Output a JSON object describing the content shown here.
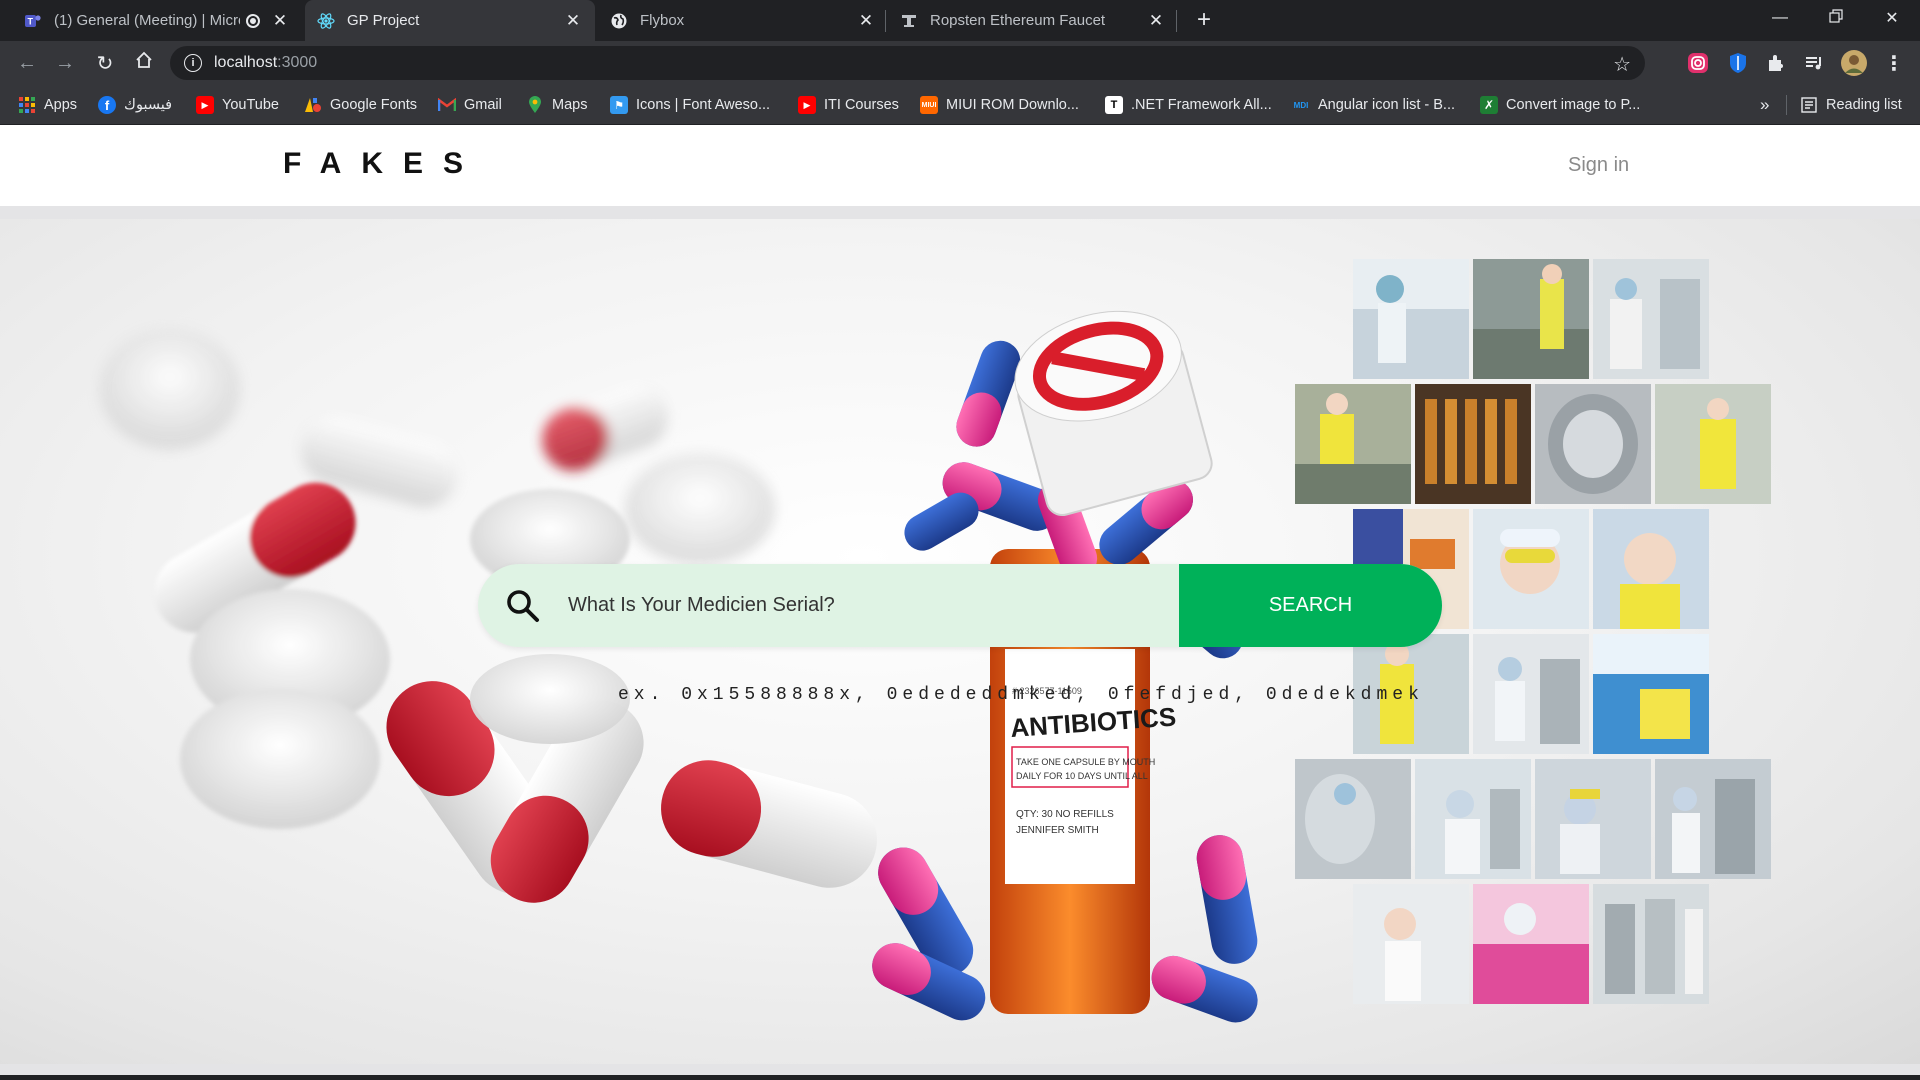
{
  "browser": {
    "tabs": [
      {
        "title": "(1) General (Meeting) | Micro",
        "active": false,
        "icon": "teams-icon"
      },
      {
        "title": "GP Project",
        "active": true,
        "icon": "react-icon"
      },
      {
        "title": "Flybox",
        "active": false,
        "icon": "globe-icon"
      },
      {
        "title": "Ropsten Ethereum Faucet",
        "active": false,
        "icon": "faucet-icon"
      }
    ],
    "address": {
      "host": "localhost",
      "port": ":3000"
    },
    "bookmarks": [
      {
        "label": "Apps",
        "icon": "apps-icon"
      },
      {
        "label": "فيسبوك",
        "icon": "facebook-icon"
      },
      {
        "label": "YouTube",
        "icon": "youtube-icon"
      },
      {
        "label": "Google Fonts",
        "icon": "google-fonts-icon"
      },
      {
        "label": "Gmail",
        "icon": "gmail-icon"
      },
      {
        "label": "Maps",
        "icon": "maps-icon"
      },
      {
        "label": "Icons | Font Aweso...",
        "icon": "fontawesome-icon"
      },
      {
        "label": "ITI Courses",
        "icon": "youtube-icon"
      },
      {
        "label": "MIUI ROM Downlo...",
        "icon": "miui-icon"
      },
      {
        "label": ".NET Framework All...",
        "icon": "dotnet-icon"
      },
      {
        "label": "Angular icon list - B...",
        "icon": "mdi-icon"
      },
      {
        "label": "Convert image to P...",
        "icon": "convert-icon"
      }
    ],
    "overflow": "»",
    "reading_list": "Reading list",
    "colors": {
      "frame": "#202124",
      "toolbar": "#35363a"
    }
  },
  "site": {
    "brand": "FAKES",
    "signin": "Sign in",
    "search": {
      "placeholder": "What Is Your Medicien Serial?",
      "button": "SEARCH"
    },
    "hint": "ex. 0x15588888x, 0edededdmked, 0fefdjed, 0dedekdmek",
    "hero_labels": {
      "bottle": "ANTIBIOTICS"
    },
    "colors": {
      "accent": "#00b159",
      "search_bg": "#dff3e4"
    }
  }
}
